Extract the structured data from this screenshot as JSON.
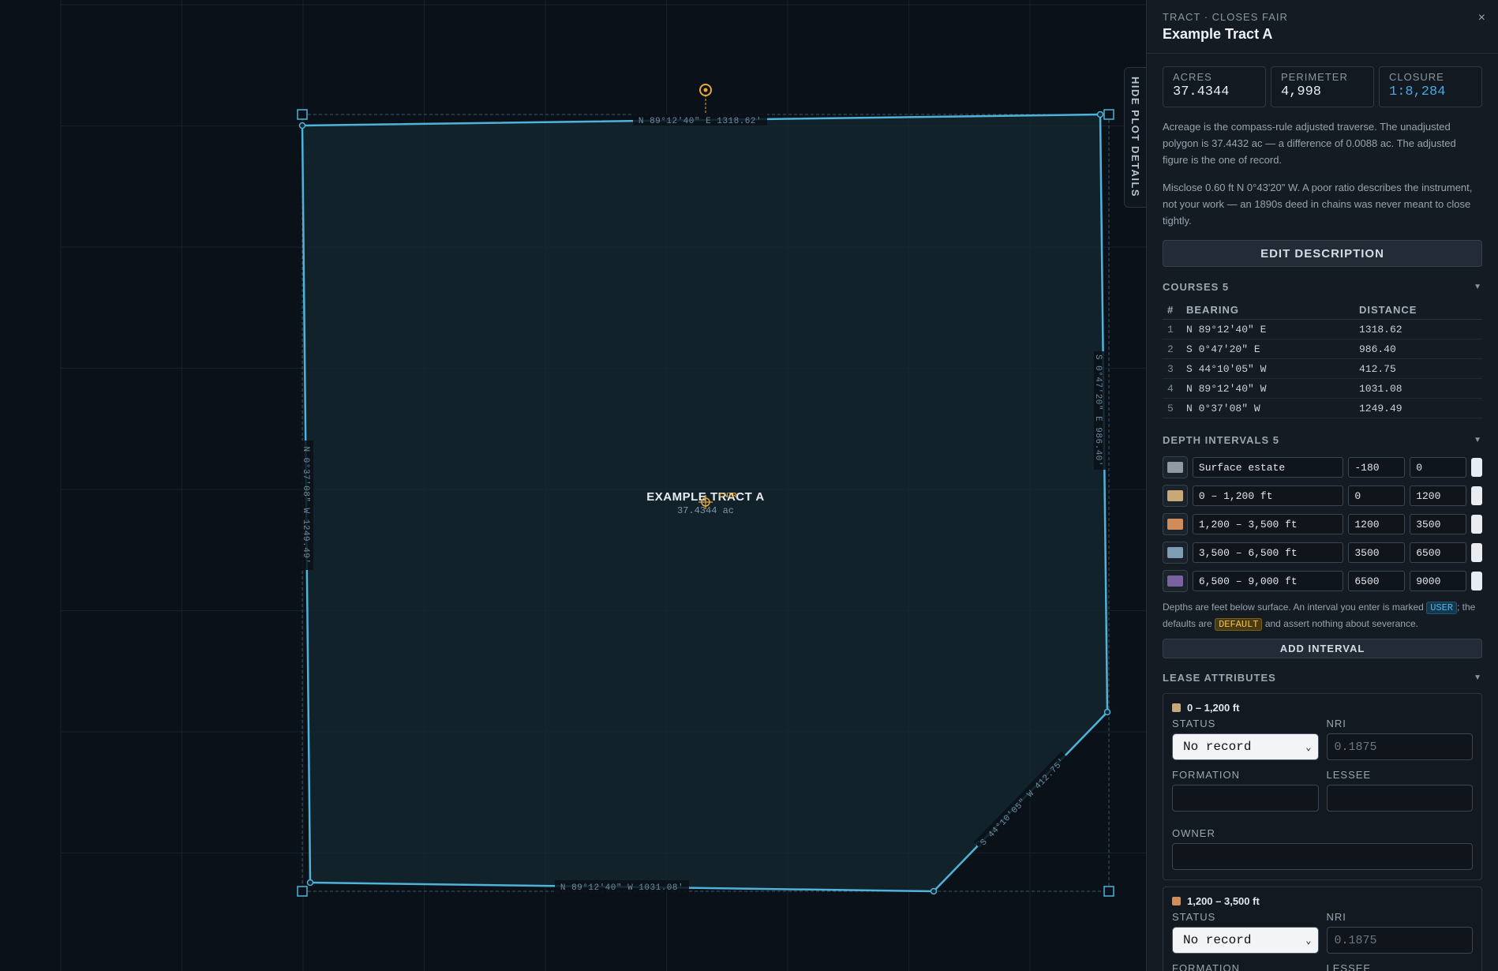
{
  "canvas": {
    "hide_tab_label": "HIDE PLOT DETAILS",
    "tract_label": "EXAMPLE TRACT A",
    "tract_acres": "37.4344 ac",
    "center_tag": "CNTR",
    "edge_labels": {
      "north": "N 89°12'40\" E  1318.62'",
      "east": "S 0°47'20\" E  986.40'",
      "southeast": "S 44°10'05\" W  412.75'",
      "south": "N 89°12'40\" W  1031.08'",
      "west": "N 0°37'08\" W  1249.49'"
    },
    "colors": {
      "outline": "#4fb3d9",
      "fill": "#13262f",
      "accent": "#e8a838",
      "grid": "#16212b"
    }
  },
  "panel": {
    "subtitle": "TRACT · CLOSES FAIR",
    "title": "Example Tract A",
    "close_glyph": "×",
    "stats": [
      {
        "label": "ACRES",
        "value": "37.4344"
      },
      {
        "label": "PERIMETER",
        "value": "4,998"
      },
      {
        "label": "CLOSURE",
        "value": "1:8,284"
      }
    ],
    "para1": "Acreage is the compass-rule adjusted traverse. The unadjusted polygon is 37.4432 ac — a difference of 0.0088 ac. The adjusted figure is the one of record.",
    "para2": "Misclose 0.60 ft N 0°43'20\" W. A poor ratio describes the instrument, not your work — an 1890s deed in chains was never meant to close tightly.",
    "edit_button": "EDIT DESCRIPTION",
    "courses": {
      "heading": "COURSES 5",
      "columns": [
        "#",
        "BEARING",
        "DISTANCE"
      ],
      "rows": [
        [
          "1",
          "N 89°12'40\" E",
          "1318.62"
        ],
        [
          "2",
          "S 0°47'20\" E",
          "986.40"
        ],
        [
          "3",
          "S 44°10'05\" W",
          "412.75"
        ],
        [
          "4",
          "N 89°12'40\" W",
          "1031.08"
        ],
        [
          "5",
          "N 0°37'08\" W",
          "1249.49"
        ]
      ]
    },
    "intervals": {
      "heading": "DEPTH INTERVALS 5",
      "rows": [
        {
          "name": "Surface estate",
          "top": "-180",
          "bottom": "0",
          "color": "#8e9aa6"
        },
        {
          "name": "0 – 1,200 ft",
          "top": "0",
          "bottom": "1200",
          "color": "#c9a878"
        },
        {
          "name": "1,200 – 3,500 ft",
          "top": "1200",
          "bottom": "3500",
          "color": "#d18c58"
        },
        {
          "name": "3,500 – 6,500 ft",
          "top": "3500",
          "bottom": "6500",
          "color": "#7e9db3"
        },
        {
          "name": "6,500 – 9,000 ft",
          "top": "6500",
          "bottom": "9000",
          "color": "#7a62a0"
        }
      ],
      "note_pre": "Depths are feet below surface. An interval you enter is marked",
      "tag_user": "USER",
      "note_mid": "; the defaults are",
      "tag_default": "DEFAULT",
      "note_post": "and assert nothing about severance.",
      "add_button": "ADD INTERVAL"
    },
    "lease": {
      "heading": "LEASE ATTRIBUTES",
      "cards": [
        {
          "name": "0 – 1,200 ft",
          "color": "#c9a878",
          "status_label": "STATUS",
          "status_value": "No record",
          "nri_label": "NRI",
          "nri_placeholder": "0.1875",
          "formation_label": "FORMATION",
          "lessee_label": "LESSEE",
          "owner_label": "OWNER"
        },
        {
          "name": "1,200 – 3,500 ft",
          "color": "#d18c58",
          "status_label": "STATUS",
          "status_value": "No record",
          "nri_label": "NRI",
          "nri_placeholder": "0.1875",
          "formation_label": "FORMATION",
          "lessee_label": "LESSEE"
        }
      ]
    }
  }
}
